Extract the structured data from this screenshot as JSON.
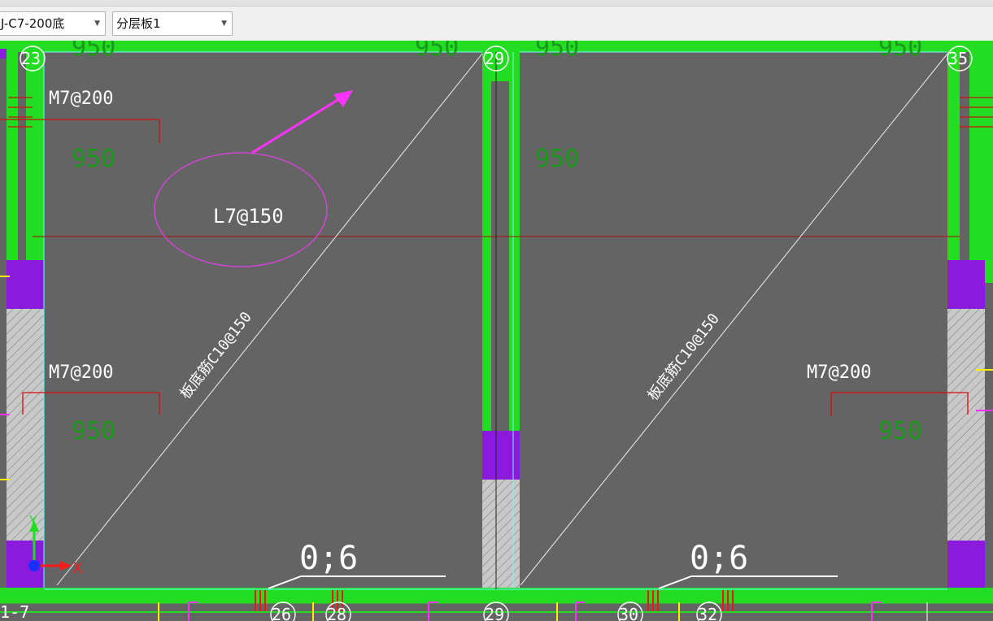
{
  "toolbar": {
    "combo_layer": {
      "value": "J-C7-200底"
    },
    "combo_slab": {
      "value": "分层板1"
    }
  },
  "drawing": {
    "axis_labels": [
      "23",
      "29",
      "35",
      "26",
      "28",
      "29",
      "30",
      "32",
      "1-7"
    ],
    "dim_950": "950",
    "rebar_top_left": "M7@200",
    "rebar_mid_left": "M7@200",
    "rebar_mid_right": "M7@200",
    "ellipse_label": "L7@150",
    "diag_left": "板底筋C10@150",
    "diag_right": "板底筋C10@150",
    "bottom_left_label": "0;6",
    "bottom_right_label": "0;6",
    "coord_x": "X",
    "coord_y": "Y"
  },
  "colors": {
    "background": "#646464",
    "wall_green": "#22dd22",
    "purple": "#8a1adc",
    "magenta": "#ff33ff",
    "dim_green": "#1a9a1a",
    "red": "#d01010"
  }
}
